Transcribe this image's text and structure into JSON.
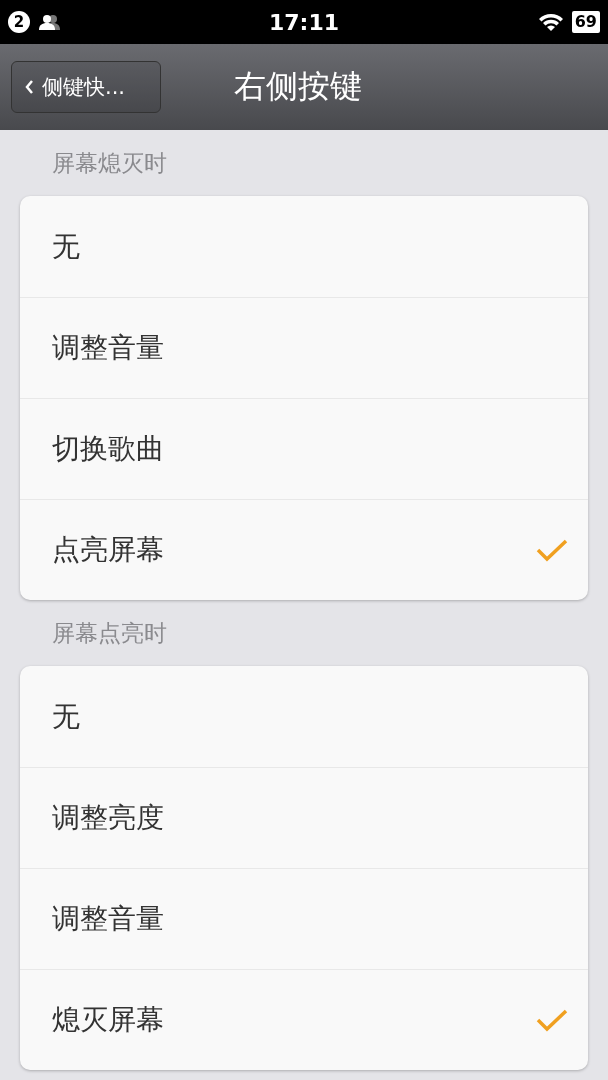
{
  "status_bar": {
    "notification_count": "2",
    "time": "17:11",
    "battery": "69"
  },
  "nav_bar": {
    "back_label": "侧键快...",
    "title": "右侧按键"
  },
  "sections": [
    {
      "title": "屏幕熄灭时",
      "options": [
        {
          "label": "无",
          "selected": false
        },
        {
          "label": "调整音量",
          "selected": false
        },
        {
          "label": "切换歌曲",
          "selected": false
        },
        {
          "label": "点亮屏幕",
          "selected": true
        }
      ]
    },
    {
      "title": "屏幕点亮时",
      "options": [
        {
          "label": "无",
          "selected": false
        },
        {
          "label": "调整亮度",
          "selected": false
        },
        {
          "label": "调整音量",
          "selected": false
        },
        {
          "label": "熄灭屏幕",
          "selected": true
        }
      ]
    }
  ]
}
